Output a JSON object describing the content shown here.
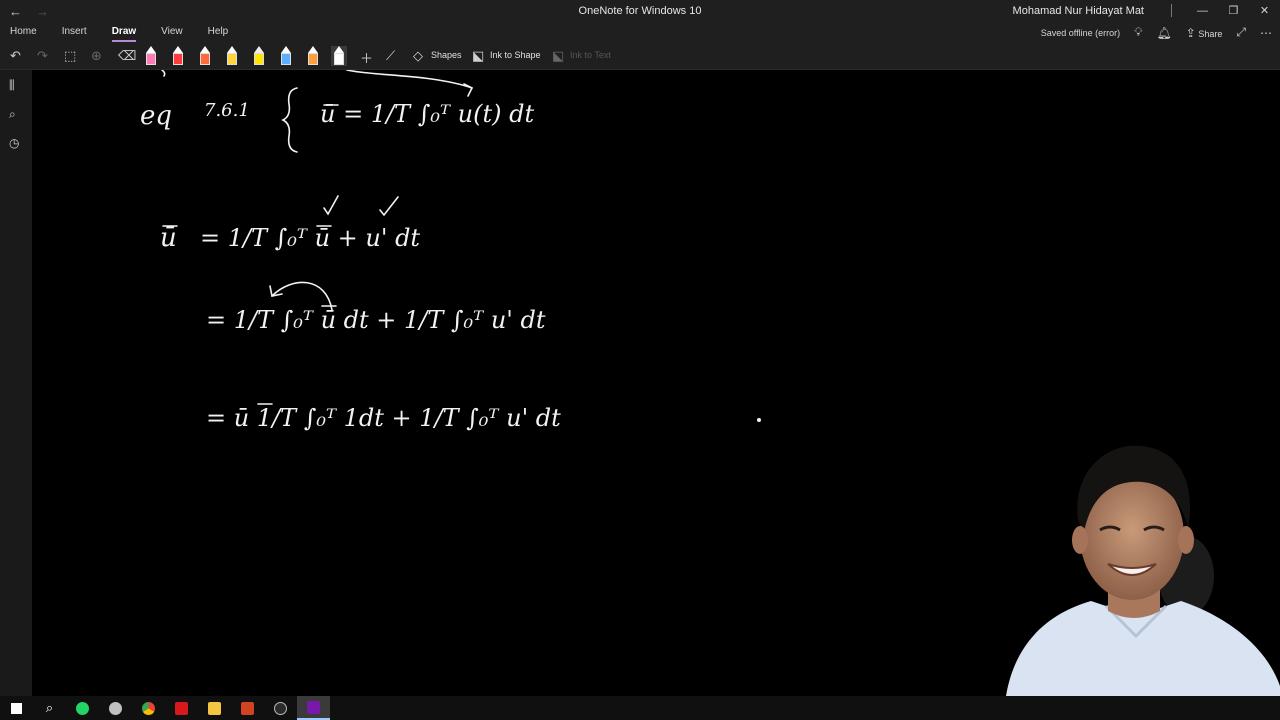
{
  "window": {
    "title": "OneNote for Windows 10",
    "user": "Mohamad Nur Hidayat Mat",
    "back_icon": "arrow-left-icon",
    "forward_icon": "arrow-right-icon",
    "controls": [
      "minimize-icon",
      "restore-icon",
      "close-icon"
    ]
  },
  "menu": {
    "tabs": [
      "Home",
      "Insert",
      "Draw",
      "View",
      "Help"
    ],
    "active": "Draw",
    "status": "Saved offline (error)",
    "share_label": "Share"
  },
  "toolbar": {
    "shapes_label": "Shapes",
    "ink_to_shape_label": "Ink to Shape",
    "ink_to_text_label": "Ink to Text",
    "pen_colors": [
      "#ff7ab6",
      "#ff3b3b",
      "#ff6a3d",
      "#ffd23f",
      "#ffe600",
      "#5ab0ff",
      "#ff9e3d",
      "#ffffff"
    ]
  },
  "ink": {
    "eq_label": "eq",
    "eq_number": "7.6.1",
    "line1": "ū = 1/T ∫₀ᵀ u(t) dt",
    "line2_lhs": "ū",
    "line2_rhs": "= 1/T ∫₀ᵀ ū + u' dt",
    "line3": "= 1/T ∫₀ᵀ ū dt + 1/T ∫₀ᵀ u' dt",
    "line4": "= ū 1/T ∫₀ᵀ 1dt + 1/T ∫₀ᵀ u' dt"
  },
  "taskbar": {
    "icons": [
      "windows-start-icon",
      "search-icon",
      "whatsapp-icon",
      "snipping-icon",
      "chrome-icon",
      "acrobat-icon",
      "file-explorer-icon",
      "powerpoint-icon",
      "obs-icon",
      "onenote-icon"
    ]
  }
}
